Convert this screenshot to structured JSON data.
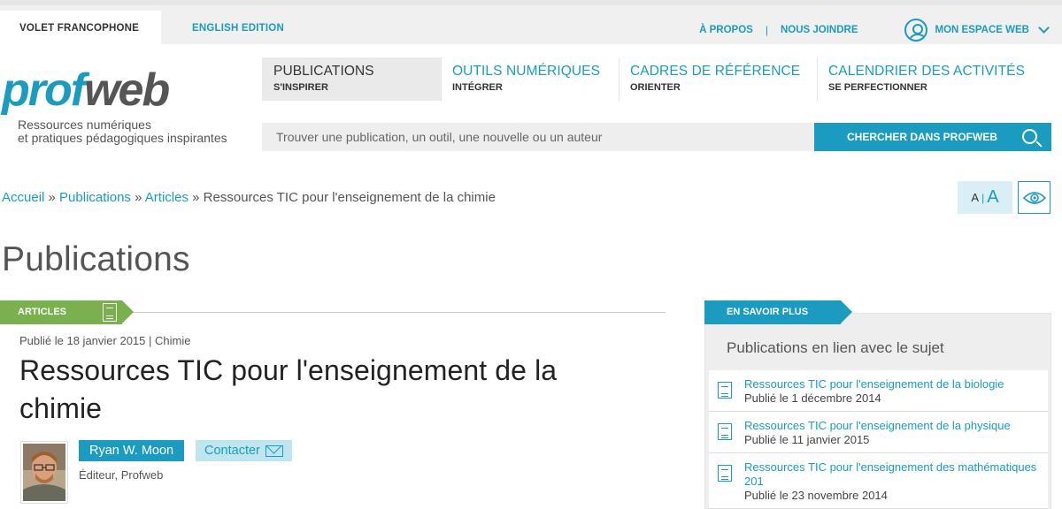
{
  "topbar": {
    "lang_fr": "VOLET FRANCOPHONE",
    "lang_en": "ENGLISH EDITION",
    "about": "À PROPOS",
    "separator": "|",
    "join": "NOUS JOINDRE",
    "my_space": "MON ESPACE WEB"
  },
  "logo": {
    "part_pro": "pro",
    "part_f": "f",
    "part_web": "web",
    "tagline_1": "Ressources numériques",
    "tagline_2": "et pratiques pédagogiques inspirantes"
  },
  "nav": [
    {
      "label": "PUBLICATIONS",
      "sub": "S'INSPIRER"
    },
    {
      "label": "OUTILS NUMÉRIQUES",
      "sub": "INTÉGRER"
    },
    {
      "label": "CADRES DE RÉFÉRENCE",
      "sub": "ORIENTER"
    },
    {
      "label": "CALENDRIER DES ACTIVITÉS",
      "sub": "SE PERFECTIONNER"
    }
  ],
  "search": {
    "placeholder": "Trouver une publication, un outil, une nouvelle ou un auteur",
    "button": "CHERCHER DANS PROFWEB"
  },
  "breadcrumb": {
    "home": "Accueil",
    "sep": "»",
    "publications": "Publications",
    "articles": "Articles",
    "current": "Ressources TIC pour l'enseignement de la chimie"
  },
  "a11y": {
    "small": "A",
    "bar": "|",
    "big": "A"
  },
  "page_title": "Publications",
  "article": {
    "tag": "ARTICLES",
    "meta": "Publié le 18 janvier 2015 | Chimie",
    "title": "Ressources TIC pour l'enseignement de la chimie",
    "author_name": "Ryan W. Moon",
    "contact": "Contacter",
    "author_role": "Éditeur, Profweb"
  },
  "sidebar": {
    "tag": "EN SAVOIR PLUS",
    "heading": "Publications en lien avec le sujet",
    "items": [
      {
        "title": "Ressources TIC pour l'enseignement de la biologie",
        "date": "Publié le 1 décembre 2014"
      },
      {
        "title": "Ressources TIC pour l'enseignement de la physique",
        "date": "Publié le 11 janvier 2015"
      },
      {
        "title": "Ressources TIC pour l'enseignement des mathématiques 201",
        "date": "Publié le 23 novembre 2014"
      }
    ]
  },
  "colors": {
    "accent": "#1a9bbf",
    "green": "#7ab04d",
    "text": "#333333"
  }
}
